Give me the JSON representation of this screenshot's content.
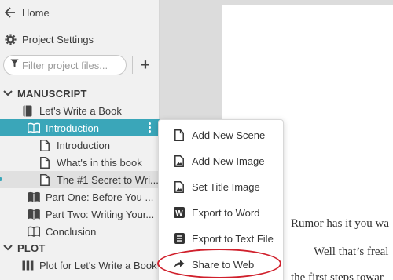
{
  "sidebar": {
    "home_label": "Home",
    "settings_label": "Project Settings",
    "search_placeholder": "Filter project files...",
    "add_label": "+",
    "manuscript_label": "MANUSCRIPT",
    "book_label": "Let's Write a Book",
    "items": [
      {
        "label": "Introduction"
      },
      {
        "label": "Introduction"
      },
      {
        "label": "What's in this book"
      },
      {
        "label": "The #1 Secret to Wri..."
      },
      {
        "label": "Part One: Before You ..."
      },
      {
        "label": "Part Two: Writing Your..."
      },
      {
        "label": "Conclusion"
      }
    ],
    "plot_label": "PLOT",
    "plot_item_label": "Plot for Let's Write a Book"
  },
  "context_menu": {
    "items": [
      {
        "label": "Add New Scene",
        "icon": "document-icon"
      },
      {
        "label": "Add New Image",
        "icon": "image-icon"
      },
      {
        "label": "Set Title Image",
        "icon": "image-icon"
      },
      {
        "label": "Export to Word",
        "icon": "word-icon"
      },
      {
        "label": "Export to Text File",
        "icon": "text-file-icon"
      },
      {
        "label": "Share to Web",
        "icon": "share-arrow-icon"
      }
    ]
  },
  "editor": {
    "line1": "Rumor has it you wa",
    "line2": "Well that’s freal",
    "line3": "the first steps towar"
  },
  "colors": {
    "accent": "#3aa6b9",
    "highlight_ring": "#d0202c"
  }
}
